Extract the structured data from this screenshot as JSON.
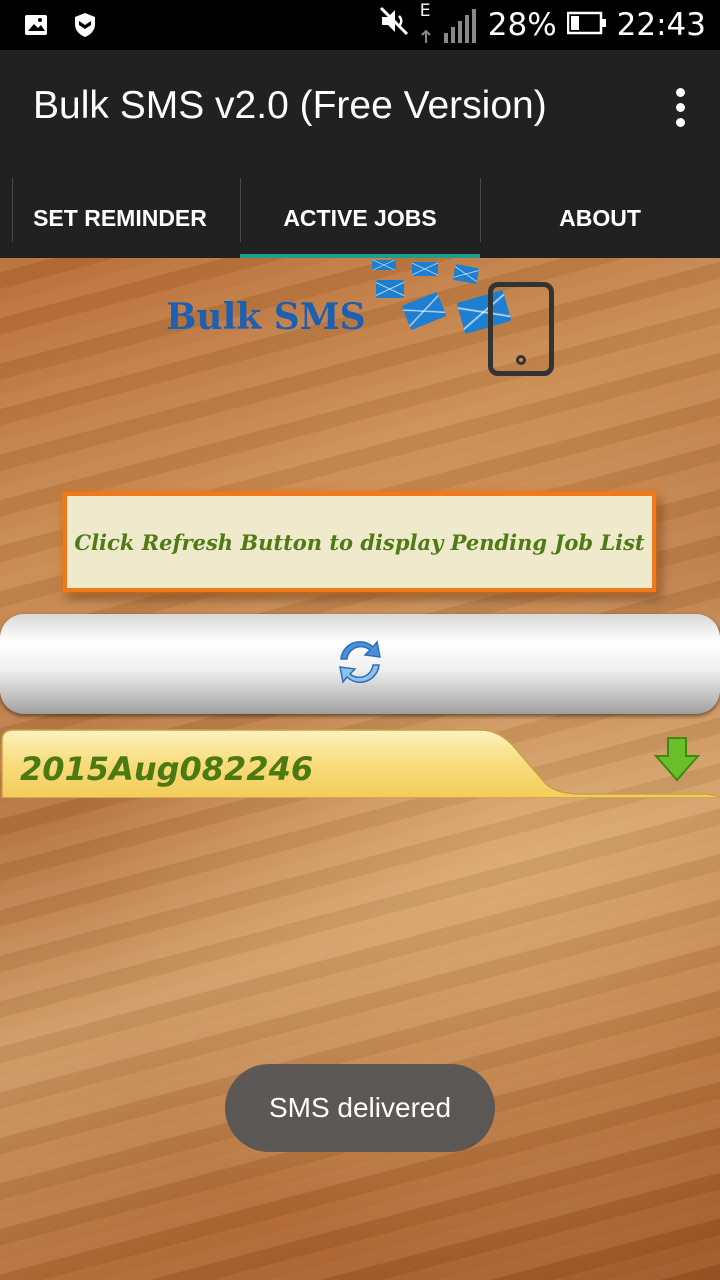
{
  "status_bar": {
    "network": "E",
    "battery": "28%",
    "time": "22:43",
    "icons": [
      "image-icon",
      "shield-icon",
      "mute-icon",
      "signal-icon",
      "battery-icon"
    ]
  },
  "app_bar": {
    "title": "Bulk SMS v2.0 (Free Version)"
  },
  "tabs": [
    {
      "label": "SET REMINDER",
      "active": false
    },
    {
      "label": "ACTIVE JOBS",
      "active": true
    },
    {
      "label": "ABOUT",
      "active": false
    }
  ],
  "logo": {
    "text": "Bulk SMS"
  },
  "notice": {
    "text": "Click Refresh Button to display Pending Job List"
  },
  "job": {
    "id": "2015Aug082246"
  },
  "toast": {
    "text": "SMS delivered"
  },
  "colors": {
    "tab_indicator": "#1f9e8f",
    "notice_border": "#f07a1a",
    "notice_text": "#4f7a16",
    "job_text": "#4c7a12"
  }
}
